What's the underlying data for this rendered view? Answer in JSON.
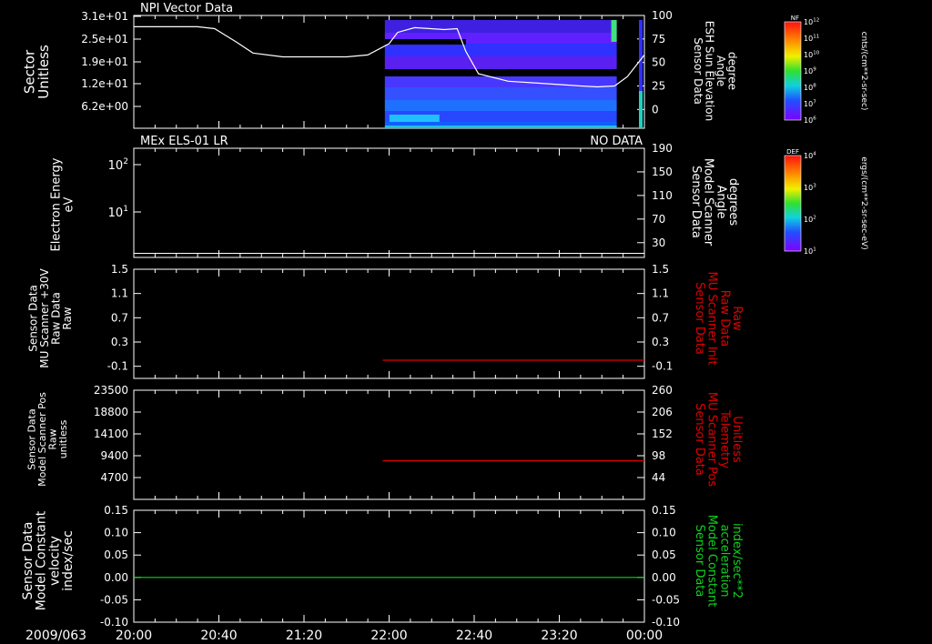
{
  "colors": {
    "background": "#000000",
    "axis": "#ffffff",
    "white_trace": "#ffffff",
    "red_trace": "#e00000",
    "green_trace": "#10d020"
  },
  "chart_data": [
    {
      "type": "heatmap",
      "title": "NPI Vector Data",
      "ylabel": [
        "Sector",
        "Unitless"
      ],
      "y_ticks": [
        "3.1e+01",
        "2.5e+01",
        "1.9e+01",
        "1.2e+01",
        "6.2e+00"
      ],
      "ylabel_right": [
        "Sensor Data",
        "ESH Sun Elevation",
        "Angle",
        "degree"
      ],
      "y_ticks_right": [
        "100",
        "75",
        "50",
        "25",
        "0"
      ],
      "ylim_right": [
        -20,
        100
      ],
      "colorbar": {
        "label": "NF",
        "units": "cnts/(cm**2-sr-sec)",
        "ticks": [
          "10^12",
          "10^11",
          "10^10",
          "10^9",
          "10^8",
          "10^7",
          "10^6"
        ]
      },
      "data_window": [
        "21:58",
        "23:47"
      ],
      "series": [
        {
          "x": [
            "20:00",
            "20:30",
            "20:38",
            "20:48",
            "20:56",
            "21:10",
            "21:40",
            "21:50",
            "22:00",
            "22:04",
            "22:12",
            "22:26",
            "22:32",
            "22:36",
            "22:42",
            "22:56",
            "23:10",
            "23:30",
            "23:38",
            "23:46",
            "23:52",
            "24:00"
          ],
          "y": [
            88,
            88,
            86,
            72,
            60,
            56,
            56,
            58,
            70,
            82,
            87,
            85,
            86,
            62,
            38,
            30,
            28,
            25,
            24,
            25,
            35,
            58
          ]
        }
      ]
    },
    {
      "type": "line",
      "title": "MEx ELS-01 LR",
      "status": "NO DATA",
      "ylabel": [
        "Electron Energy",
        "eV"
      ],
      "y_ticks": [
        "10^2",
        "10^1"
      ],
      "ylabel_right": [
        "Sensor Data",
        "Model Scanner",
        "Angle",
        "degrees"
      ],
      "y_ticks_right": [
        "190",
        "150",
        "110",
        "70",
        "30"
      ],
      "ylim_right": [
        5,
        190
      ],
      "colorbar": {
        "label": "DEF",
        "units": "ergs/(cm**2-sr-sec-eV)",
        "ticks": [
          "10^4",
          "10^3",
          "10^2",
          "10^1"
        ]
      },
      "series": [
        {
          "x": [
            "20:00",
            "24:00"
          ],
          "y": [
            12,
            12
          ]
        }
      ]
    },
    {
      "type": "line",
      "ylabel": [
        "Sensor Data",
        "MU Scanner +30V",
        "Raw Data",
        "Raw"
      ],
      "y_ticks": [
        "1.5",
        "1.1",
        "0.7",
        "0.3",
        "-0.1"
      ],
      "ylabel_right": [
        "Sensor Data",
        "MU Scanner Init",
        "Raw Data",
        "Raw"
      ],
      "y_ticks_right": [
        "1.5",
        "1.1",
        "0.7",
        "0.3",
        "-0.1"
      ],
      "ylim": [
        -0.3,
        1.5
      ],
      "series": [
        {
          "x": [
            "21:57",
            "24:00"
          ],
          "y": [
            0,
            0
          ]
        }
      ]
    },
    {
      "type": "line",
      "ylabel": [
        "Sensor Data",
        "Model Scanner Pos",
        "Raw",
        "unitless"
      ],
      "y_ticks": [
        "23500",
        "18800",
        "14100",
        "9400",
        "4700"
      ],
      "ylabel_right": [
        "Sensor Data",
        "MU Scanner Pos",
        "Telemetry",
        "Unitless"
      ],
      "y_ticks_right": [
        "260",
        "206",
        "152",
        "98",
        "44"
      ],
      "ylim": [
        0,
        23500
      ],
      "series": [
        {
          "x": [
            "21:57",
            "24:00"
          ],
          "y": [
            8300,
            8300
          ]
        }
      ]
    },
    {
      "type": "line",
      "ylabel": [
        "Sensor Data",
        "Model Constant",
        "velocity",
        "index/sec"
      ],
      "y_ticks": [
        "0.15",
        "0.10",
        "0.05",
        "0.00",
        "-0.05",
        "-0.10"
      ],
      "ylabel_right": [
        "Sensor Data",
        "Model Constant",
        "acceleration",
        "index/sec**2"
      ],
      "y_ticks_right": [
        "0.15",
        "0.10",
        "0.05",
        "0.00",
        "-0.05",
        "-0.10"
      ],
      "ylim": [
        -0.1,
        0.15
      ],
      "series": [
        {
          "x": [
            "20:00",
            "24:00"
          ],
          "y": [
            0,
            0
          ]
        }
      ]
    }
  ],
  "x_axis": {
    "date_label": "2009/063",
    "ticks": [
      "20:00",
      "20:40",
      "21:20",
      "22:00",
      "22:40",
      "23:20",
      "00:00"
    ],
    "xlim": [
      "20:00",
      "24:00"
    ]
  }
}
